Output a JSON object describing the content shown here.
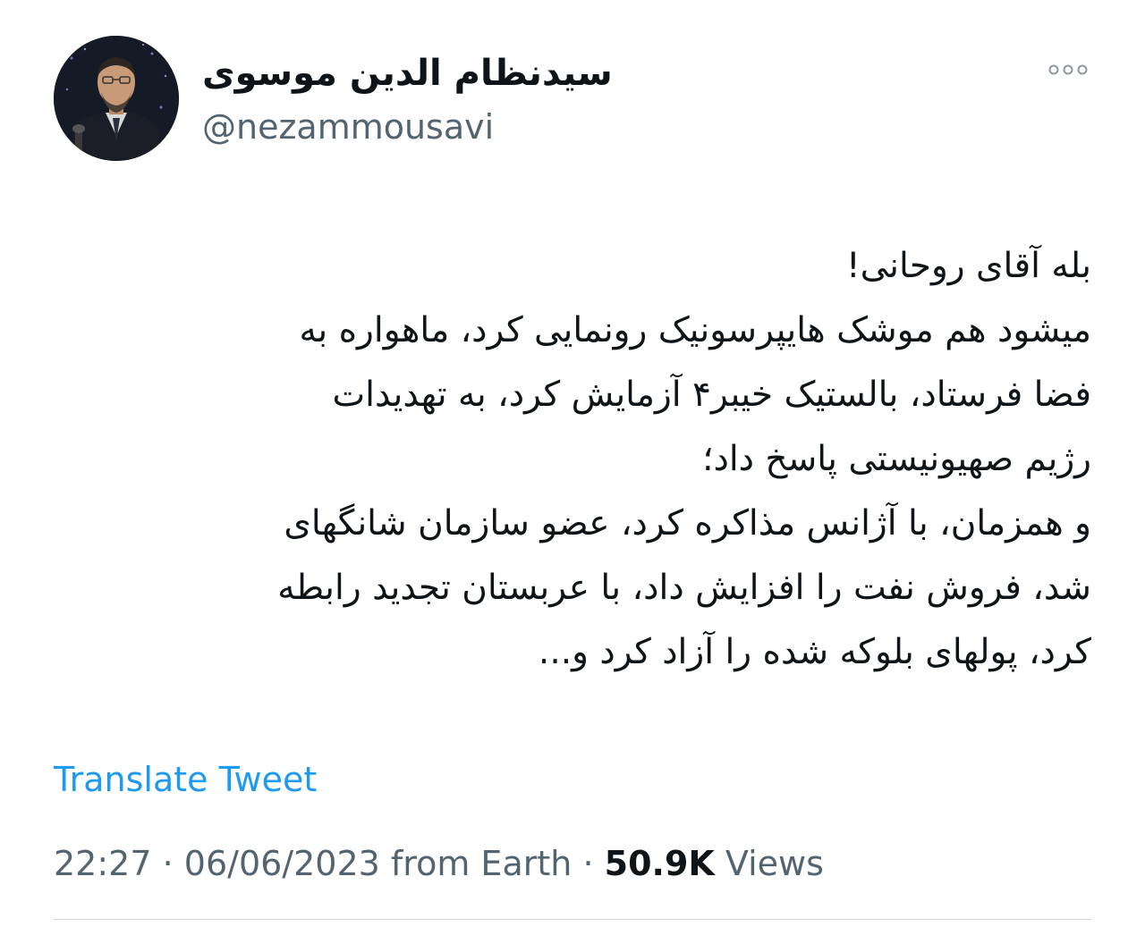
{
  "author": {
    "display_name": "سیدنظام الدین موسوی",
    "handle": "@nezammousavi",
    "avatar_icon": "profile-photo"
  },
  "more_icon": "more-horizontal-icon",
  "tweet": {
    "lines": [
      "بله آقای روحانی!",
      "میشود هم موشک هایپرسونیک رونمایی کرد، ماهواره به",
      "فضا فرستاد، بالستیک خیبر۴ آزمایش کرد، به تهدیدات",
      "رژیم صهیونیستی پاسخ داد؛",
      "و همزمان، با آژانس مذاکره کرد، عضو سازمان شانگهای",
      "شد، فروش نفت را افزایش داد، با عربستان تجدید رابطه",
      "کرد، پولهای بلوکه شده را آزاد کرد و..."
    ]
  },
  "translate_label": "Translate Tweet",
  "meta": {
    "time": "22:27",
    "separator": "·",
    "date": "06/06/2023",
    "source": "from Earth",
    "views_count": "50.9K",
    "views_label": "Views"
  },
  "colors": {
    "text": "#0f1419",
    "secondary": "#536471",
    "link": "#1d9bf0",
    "divider": "#cfd9de"
  }
}
